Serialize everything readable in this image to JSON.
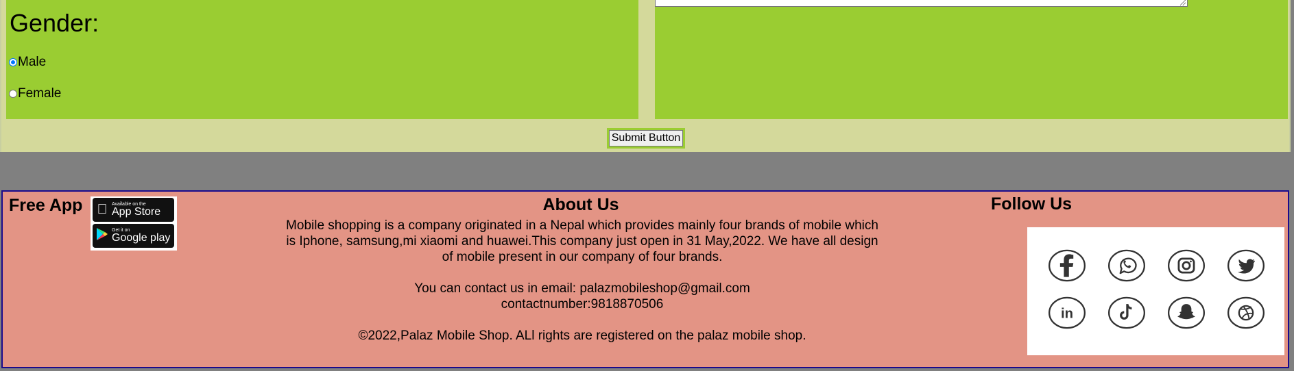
{
  "form": {
    "gender_title": "Gender:",
    "gender_options": [
      {
        "label": "Male",
        "checked": true
      },
      {
        "label": "Female",
        "checked": false
      }
    ],
    "submit_label": "Submit Button"
  },
  "footer": {
    "free_app_label": "Free App",
    "badges": {
      "app_store_small": "Available on the",
      "app_store_big": "App Store",
      "google_small": "Get it on",
      "google_big": "Google play"
    },
    "about_title": "About Us",
    "about_description": "Mobile shopping is a company originated in a Nepal which provides mainly four brands of mobile which is Iphone, samsung,mi xiaomi and huawei.This company just open in 31 May,2022. We have all design of mobile present in our company of four brands.",
    "contact_email": "You can contact us in email: palazmobileshop@gmail.com",
    "contact_number": "contactnumber:9818870506",
    "copyright": "©2022,Palaz Mobile Shop. ALl rights are registered on the palaz mobile shop.",
    "follow_title": "Follow Us",
    "social_icons": [
      "facebook-icon",
      "whatsapp-icon",
      "instagram-icon",
      "twitter-icon",
      "linkedin-icon",
      "tiktok-icon",
      "snapchat-icon",
      "dribbble-icon"
    ]
  },
  "colors": {
    "panel_green": "#9acd32",
    "form_bg": "#d4d99b",
    "footer_bg": "#e39485",
    "footer_border": "#1a0a8c",
    "page_bg": "#808080"
  }
}
